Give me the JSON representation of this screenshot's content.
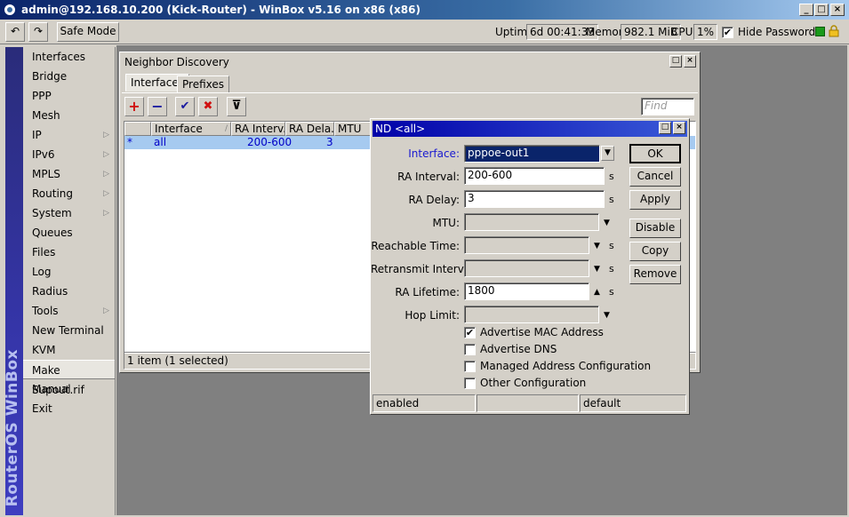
{
  "window": {
    "title": "admin@192.168.10.200 (Kick-Router) - WinBox v5.16 on x86 (x86)",
    "min": "_",
    "max": "□",
    "close": "×"
  },
  "toolbar": {
    "undo": "↶",
    "redo": "↷",
    "safe_mode": "Safe Mode",
    "uptime_label": "Uptime:",
    "uptime_value": "6d 00:41:33",
    "memory_label": "Memory:",
    "memory_value": "982.1 MiB",
    "cpu_label": "CPU:",
    "cpu_value": "1%",
    "hide_passwords_label": "Hide Passwords",
    "hide_passwords_checked": "✔",
    "status_color": "#1a9a1a"
  },
  "brand": "RouterOS WinBox",
  "sidebar": {
    "items": [
      {
        "label": "Interfaces"
      },
      {
        "label": "Bridge"
      },
      {
        "label": "PPP"
      },
      {
        "label": "Mesh"
      },
      {
        "label": "IP",
        "submenu": "▷"
      },
      {
        "label": "IPv6",
        "submenu": "▷"
      },
      {
        "label": "MPLS",
        "submenu": "▷"
      },
      {
        "label": "Routing",
        "submenu": "▷"
      },
      {
        "label": "System",
        "submenu": "▷"
      },
      {
        "label": "Queues"
      },
      {
        "label": "Files"
      },
      {
        "label": "Log"
      },
      {
        "label": "Radius"
      },
      {
        "label": "Tools",
        "submenu": "▷"
      },
      {
        "label": "New Terminal"
      },
      {
        "label": "KVM"
      },
      {
        "label": "Make Supout.rif"
      },
      {
        "label": "Manual"
      },
      {
        "label": "Exit"
      }
    ]
  },
  "nd_window": {
    "title": "Neighbor Discovery",
    "tabs": [
      "Interfaces",
      "Prefixes"
    ],
    "tools": {
      "add": "+",
      "remove": "−",
      "enable": "✔",
      "disable": "✖",
      "filter": "⊽"
    },
    "find_placeholder": "Find",
    "columns": [
      "Interface",
      "RA Interv...",
      "RA Dela...",
      "MTU"
    ],
    "sort_indicator": "/",
    "rows": [
      {
        "flag": "*",
        "interface": "all",
        "ra_interval": "200-600",
        "ra_delay": "3",
        "mtu": ""
      }
    ],
    "footer": "1 item (1 selected)"
  },
  "dialog": {
    "title": "ND <all>",
    "fields": {
      "interface": {
        "label": "Interface:",
        "value": "pppoe-out1"
      },
      "ra_interval": {
        "label": "RA Interval:",
        "value": "200-600",
        "unit": "s"
      },
      "ra_delay": {
        "label": "RA Delay:",
        "value": "3",
        "unit": "s"
      },
      "mtu": {
        "label": "MTU:",
        "value": ""
      },
      "reachable_time": {
        "label": "Reachable Time:",
        "value": "",
        "unit": "s"
      },
      "retransmit_interval": {
        "label": "Retransmit Interval:",
        "value": "",
        "unit": "s"
      },
      "ra_lifetime": {
        "label": "RA Lifetime:",
        "value": "1800",
        "unit": "s"
      },
      "hop_limit": {
        "label": "Hop Limit:",
        "value": ""
      }
    },
    "checkboxes": [
      {
        "label": "Advertise MAC Address",
        "checked": "✔"
      },
      {
        "label": "Advertise DNS",
        "checked": ""
      },
      {
        "label": "Managed Address Configuration",
        "checked": ""
      },
      {
        "label": "Other Configuration",
        "checked": ""
      }
    ],
    "buttons": {
      "ok": "OK",
      "cancel": "Cancel",
      "apply": "Apply",
      "disable": "Disable",
      "copy": "Copy",
      "remove": "Remove"
    },
    "status": [
      "enabled",
      "",
      "default"
    ]
  }
}
